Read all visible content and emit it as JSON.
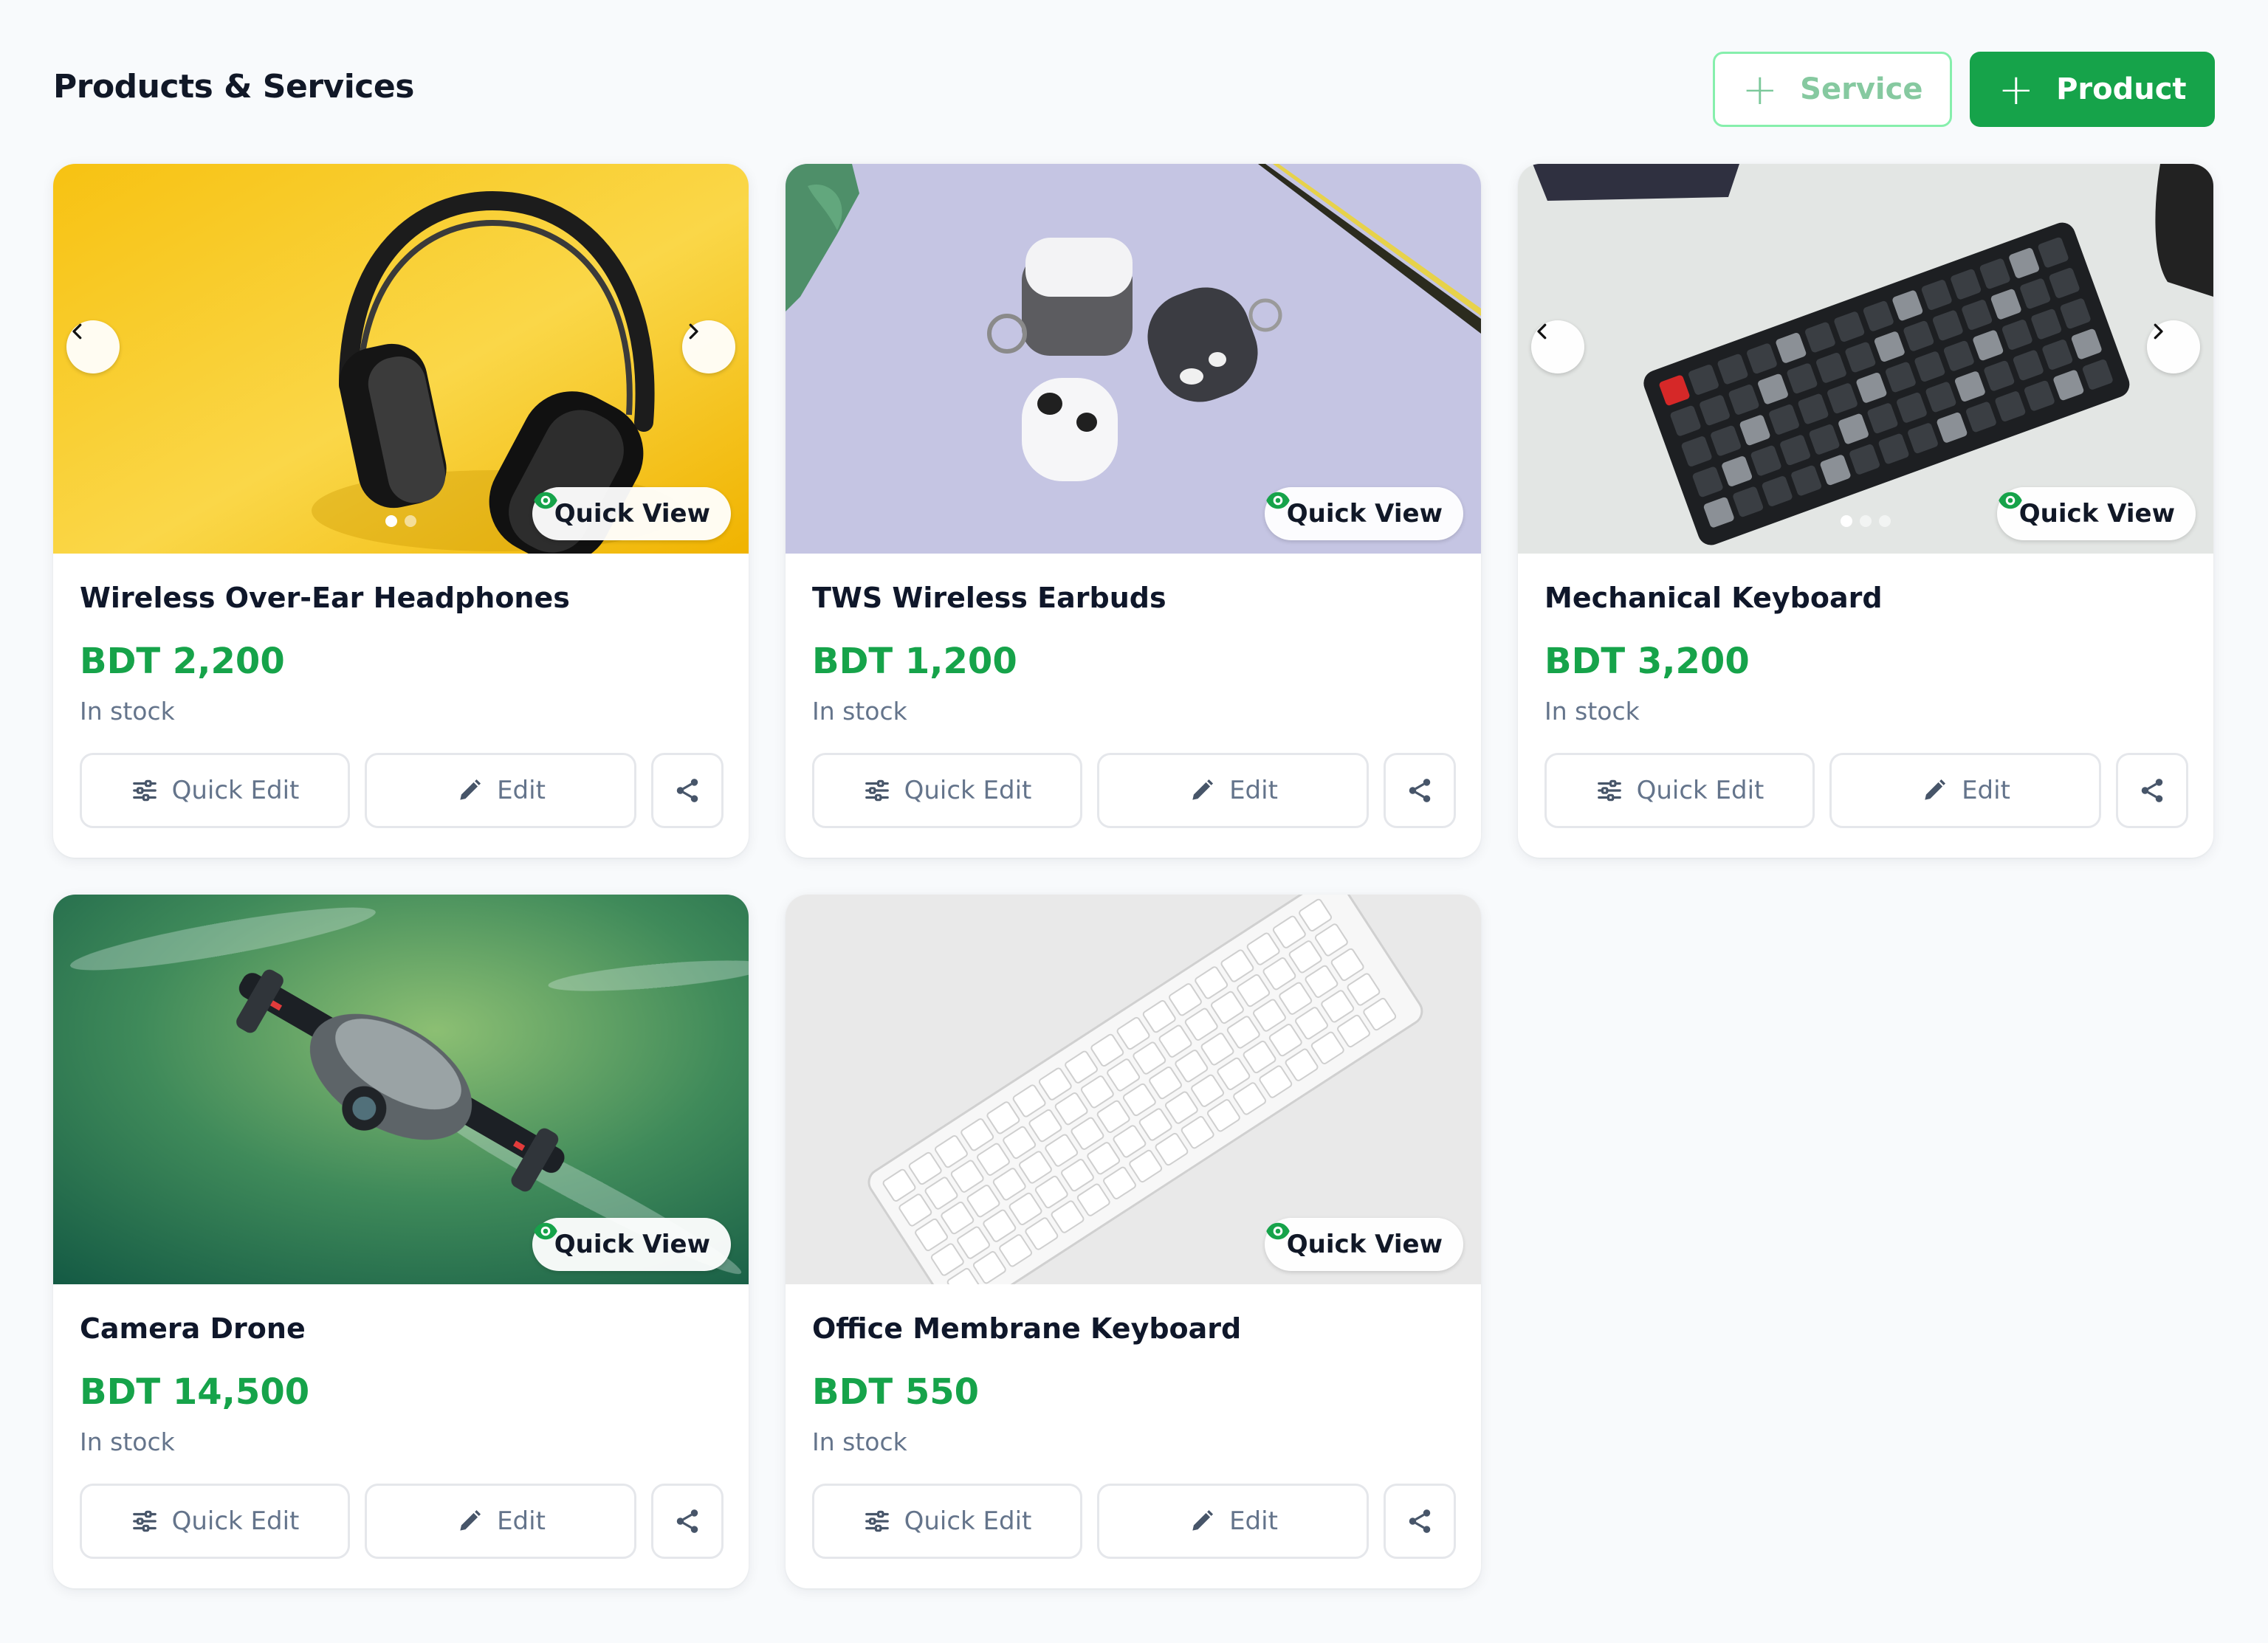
{
  "header": {
    "title": "Products & Services",
    "service_button": "Service",
    "product_button": "Product"
  },
  "colors": {
    "brand_green": "#16a34a",
    "page_bg": "#f8fafc",
    "muted_text": "#64748b"
  },
  "labels": {
    "quick_view": "Quick View",
    "quick_edit": "Quick Edit",
    "edit": "Edit"
  },
  "products": [
    {
      "name": "Wireless Over-Ear Headphones",
      "price": "BDT 2,200",
      "stock": "In stock",
      "image_count": 2,
      "active_image": 1
    },
    {
      "name": "TWS Wireless Earbuds",
      "price": "BDT 1,200",
      "stock": "In stock",
      "image_count": 1,
      "active_image": 1
    },
    {
      "name": "Mechanical Keyboard",
      "price": "BDT 3,200",
      "stock": "In stock",
      "image_count": 3,
      "active_image": 1
    },
    {
      "name": "Camera Drone",
      "price": "BDT 14,500",
      "stock": "In stock",
      "image_count": 1,
      "active_image": 1
    },
    {
      "name": "Office Membrane Keyboard",
      "price": "BDT 550",
      "stock": "In stock",
      "image_count": 1,
      "active_image": 1
    }
  ],
  "icons": {
    "quick_view": "eye-icon",
    "quick_edit": "sliders-icon",
    "edit": "pencil-icon",
    "share": "share-icon",
    "prev": "chevron-left-icon",
    "next": "chevron-right-icon",
    "add": "plus-icon"
  }
}
